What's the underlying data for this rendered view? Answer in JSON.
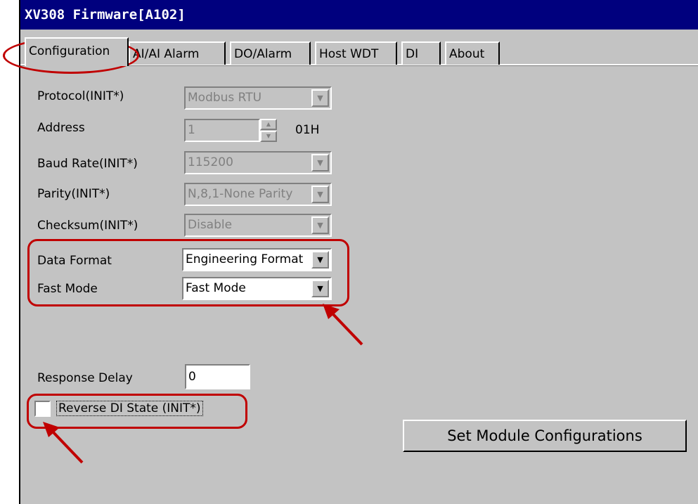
{
  "window": {
    "title": "XV308 Firmware[A102]"
  },
  "tabs": [
    {
      "label": "Configuration"
    },
    {
      "label": "AI/AI Alarm"
    },
    {
      "label": "DO/Alarm"
    },
    {
      "label": "Host WDT"
    },
    {
      "label": "DI"
    },
    {
      "label": "About"
    }
  ],
  "form": {
    "protocol": {
      "label": "Protocol(INIT*)",
      "value": "Modbus RTU"
    },
    "address": {
      "label": "Address",
      "value": "1",
      "hex": "01H"
    },
    "baud_rate": {
      "label": "Baud Rate(INIT*)",
      "value": "115200"
    },
    "parity": {
      "label": "Parity(INIT*)",
      "value": "N,8,1-None Parity"
    },
    "checksum": {
      "label": "Checksum(INIT*)",
      "value": "Disable"
    },
    "data_format": {
      "label": "Data Format",
      "value": "Engineering Format"
    },
    "fast_mode": {
      "label": "Fast Mode",
      "value": "Fast Mode"
    },
    "response_delay": {
      "label": "Response Delay",
      "value": "0"
    },
    "reverse_di": {
      "label": "Reverse DI State (INIT*)",
      "checked": false
    },
    "set_button": "Set Module Configurations"
  },
  "annotation_color": "#c00000"
}
